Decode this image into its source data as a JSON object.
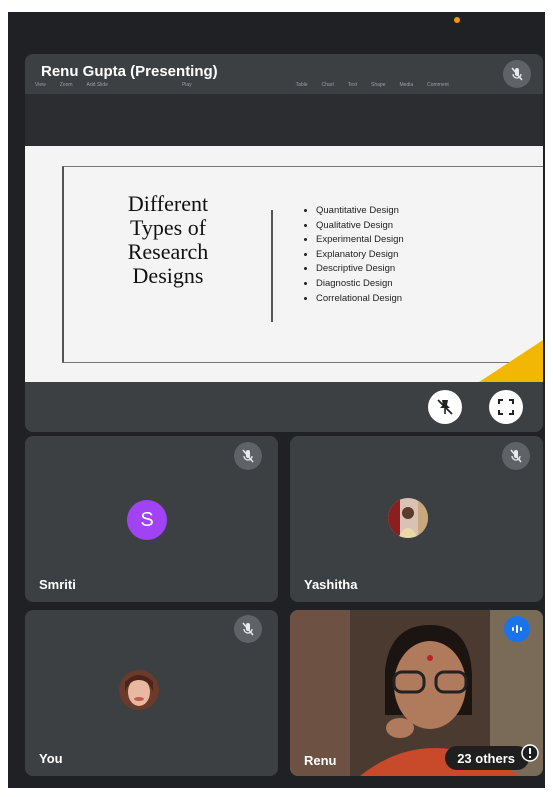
{
  "presentation": {
    "presenter_label": "Renu Gupta (Presenting)",
    "toolbar_items": [
      "View",
      "Zoom",
      "Add Slide",
      "Play",
      "Table",
      "Chart",
      "Text",
      "Shape",
      "Media",
      "Comment"
    ],
    "slide": {
      "title_lines": [
        "Different",
        "Types of",
        "Research",
        "Designs"
      ],
      "bullets": [
        "Quantitative Design",
        "Qualitative Design",
        "Experimental Design",
        "Explanatory Design",
        "Descriptive Design",
        "Diagnostic Design",
        "Correlational Design"
      ]
    }
  },
  "participants": {
    "smriti": {
      "name": "Smriti",
      "initial": "S"
    },
    "yashitha": {
      "name": "Yashitha"
    },
    "you": {
      "name": "You"
    },
    "renu": {
      "name": "Renu",
      "others_label": "23 others"
    }
  },
  "colors": {
    "background": "#202124",
    "tile": "#3c4043",
    "avatar_purple": "#a142f4",
    "speaking_blue": "#1a73e8",
    "slide_accent": "#f2b705"
  }
}
